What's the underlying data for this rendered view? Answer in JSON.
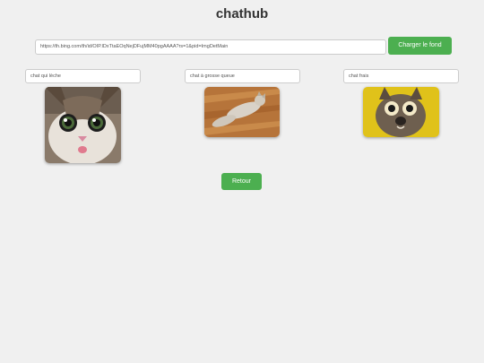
{
  "app": {
    "title": "chathub"
  },
  "background_form": {
    "url_value": "https://th.bing.com/th/id/OIP.lDxTtaEOqNejDFujMM40pgAAAA?rs=1&pid=ImgDetMain",
    "load_label": "Charger le fond"
  },
  "cards": [
    {
      "label": "chat qui lèche",
      "image": "cat-closeup-photo"
    },
    {
      "label": "chat à grosse queue",
      "image": "cat-on-wood-floor-photo"
    },
    {
      "label": "chat frais",
      "image": "startled-cat-yellow-photo"
    }
  ],
  "back_label": "Retour",
  "colors": {
    "accent": "#4caf50",
    "background": "#f0f0f0"
  }
}
